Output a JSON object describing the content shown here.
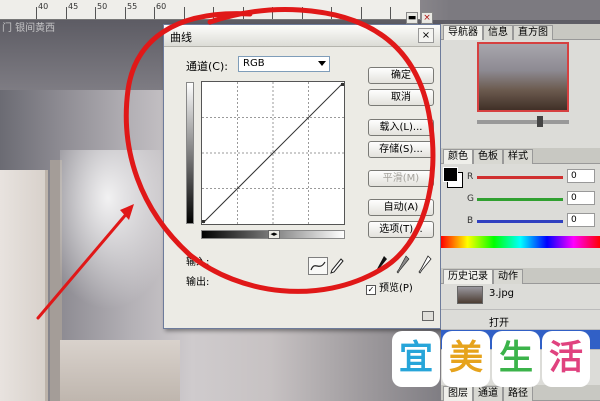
{
  "ruler": {
    "marks": [
      "40",
      "45",
      "50",
      "55",
      "60"
    ]
  },
  "tab_text": "门 银间黄西",
  "dialog": {
    "title": "曲线",
    "close_label": "×",
    "channel_label": "通道(C):",
    "channel_value": "RGB",
    "input_label": "输入:",
    "output_label": "输出:",
    "buttons": {
      "ok": "确定",
      "cancel": "取消",
      "load": "载入(L)...",
      "save": "存储(S)...",
      "smooth": "平滑(M)",
      "auto": "自动(A)",
      "options": "选项(T)..."
    },
    "preview_label": "预览(P)",
    "preview_checked": true
  },
  "panels": {
    "navigator_tabs": [
      "导航器",
      "信息",
      "直方图"
    ],
    "color_tabs": [
      "颜色",
      "色板",
      "样式"
    ],
    "color_channels": [
      {
        "label": "R",
        "value": "0",
        "color": "#d03030"
      },
      {
        "label": "G",
        "value": "0",
        "color": "#30a030"
      },
      {
        "label": "B",
        "value": "0",
        "color": "#3040c0"
      }
    ],
    "history_tabs": [
      "历史记录",
      "动作"
    ],
    "history_items": [
      {
        "label": "3.jpg"
      },
      {
        "label": "打开"
      }
    ],
    "layer_tabs": [
      "图层",
      "通道",
      "路径"
    ]
  },
  "watermark": {
    "chars": [
      {
        "char": "宜",
        "color": "#27a5d9"
      },
      {
        "char": "美",
        "color": "#e6a31c"
      },
      {
        "char": "生",
        "color": "#3bb34a"
      },
      {
        "char": "活",
        "color": "#e0427f"
      }
    ]
  },
  "colors": {
    "annotation_red": "#e01818",
    "dialog_bg": "#ecebe5"
  }
}
